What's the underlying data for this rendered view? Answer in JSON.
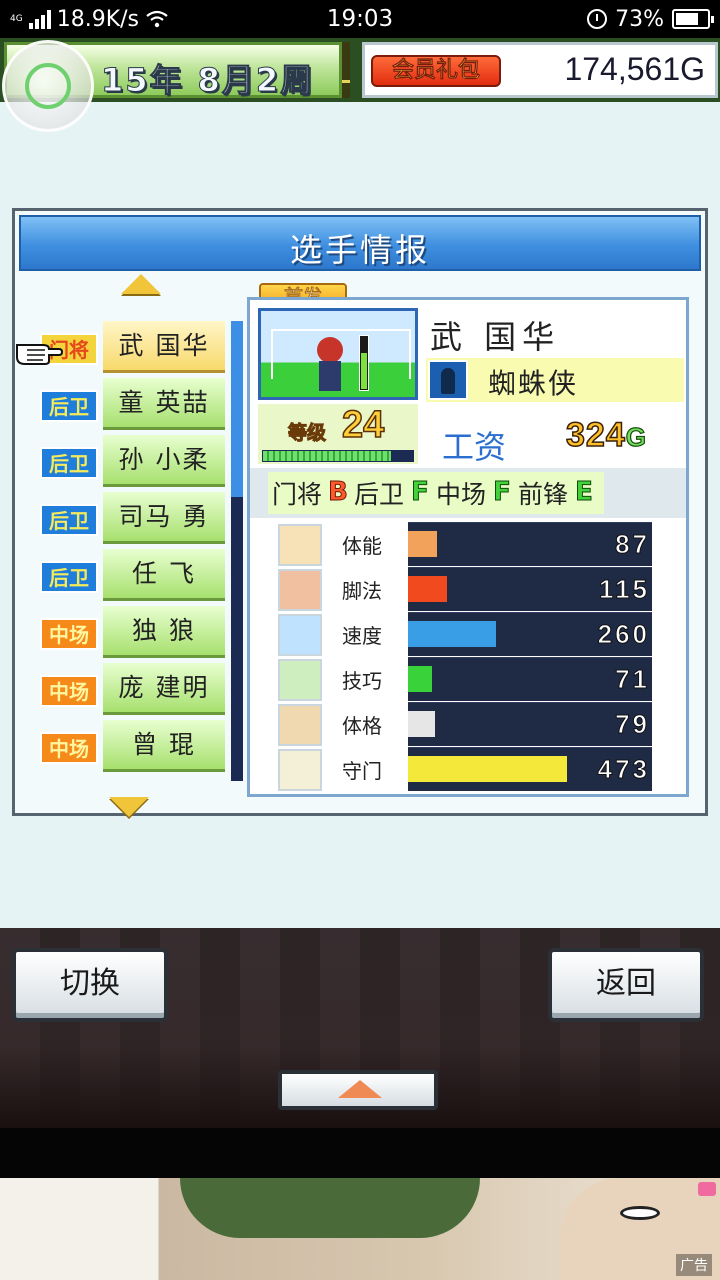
{
  "status_bar": {
    "network_type": "4G",
    "speed": "18.9K/s",
    "time": "19:03",
    "battery": "73%",
    "battery_level": 0.73
  },
  "top_bar": {
    "date_year": "15年",
    "date_week": "8月2周",
    "vip_label": "会员礼包",
    "money": "174,561G"
  },
  "window": {
    "title": "选手情报"
  },
  "players": [
    {
      "position": "门将",
      "pos_code": "GK",
      "name": "武 国华",
      "selected": true
    },
    {
      "position": "后卫",
      "pos_code": "DF",
      "name": "童 英喆"
    },
    {
      "position": "后卫",
      "pos_code": "DF",
      "name": "孙 小柔"
    },
    {
      "position": "后卫",
      "pos_code": "DF",
      "name": "司马 勇"
    },
    {
      "position": "后卫",
      "pos_code": "DF",
      "name": "任 飞"
    },
    {
      "position": "中场",
      "pos_code": "MF",
      "name": "独 狼"
    },
    {
      "position": "中场",
      "pos_code": "MF",
      "name": "庞 建明"
    },
    {
      "position": "中场",
      "pos_code": "MF",
      "name": "曾 琨"
    }
  ],
  "detail": {
    "starter_label": "首发",
    "name": "武 国华",
    "skill": "蜘蛛侠",
    "level_label": "等级",
    "level": "24",
    "level_progress": 0.85,
    "salary_label": "工资",
    "salary_value": "324",
    "salary_unit": "G",
    "aptitudes": [
      {
        "position": "门将",
        "grade": "B"
      },
      {
        "position": "后卫",
        "grade": "F"
      },
      {
        "position": "中场",
        "grade": "F"
      },
      {
        "position": "前锋",
        "grade": "E"
      }
    ],
    "stats": [
      {
        "name": "体能",
        "value": "87",
        "fraction": 0.12,
        "color": "#f2a25a",
        "icon": "battery-icon"
      },
      {
        "name": "脚法",
        "value": "115",
        "fraction": 0.16,
        "color": "#f04a1e",
        "icon": "kick-icon"
      },
      {
        "name": "速度",
        "value": "260",
        "fraction": 0.36,
        "color": "#3a9ee6",
        "icon": "runner-icon"
      },
      {
        "name": "技巧",
        "value": "71",
        "fraction": 0.1,
        "color": "#3ad23a",
        "icon": "dribble-icon"
      },
      {
        "name": "体格",
        "value": "79",
        "fraction": 0.11,
        "color": "#e6e6e6",
        "icon": "muscle-icon"
      },
      {
        "name": "守门",
        "value": "473",
        "fraction": 0.65,
        "color": "#f4e83a",
        "icon": "glove-icon"
      }
    ]
  },
  "buttons": {
    "switch_label": "切换",
    "back_label": "返回"
  },
  "ad": {
    "label": "广告"
  }
}
